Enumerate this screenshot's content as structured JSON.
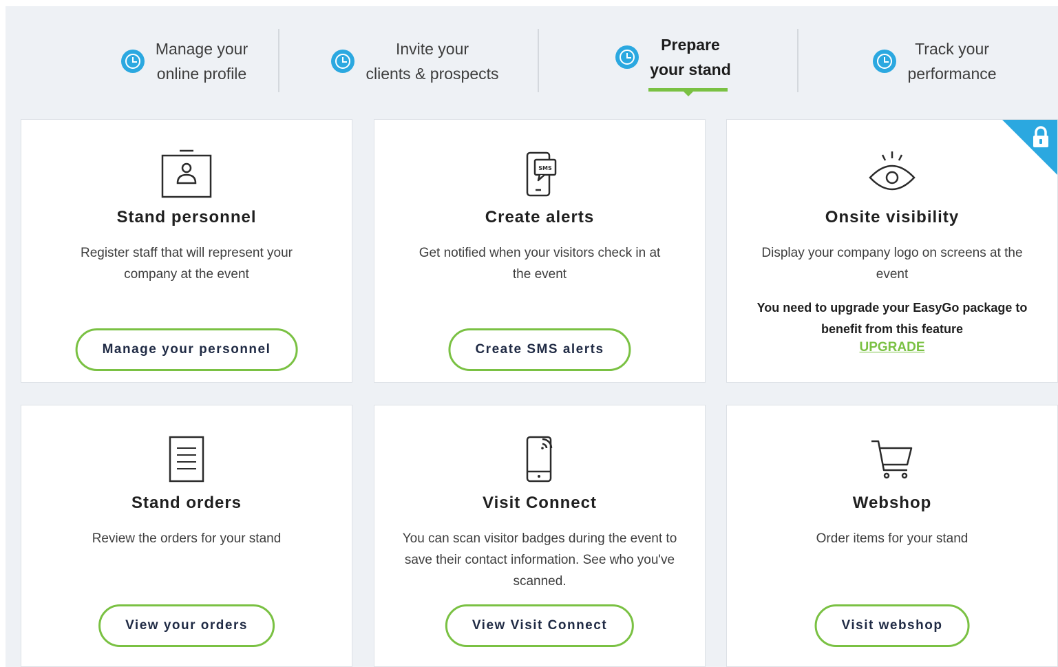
{
  "steps": [
    {
      "label": "Manage your\nonline profile",
      "active": false
    },
    {
      "label": "Invite your\nclients & prospects",
      "active": false
    },
    {
      "label": "Prepare\nyour stand",
      "active": true
    },
    {
      "label": "Track your\nperformance",
      "active": false
    }
  ],
  "cards": [
    {
      "icon": "badge-icon",
      "title": "Stand personnel",
      "description": "Register staff that will represent your company at the event",
      "button": "Manage your personnel"
    },
    {
      "icon": "sms-phone-icon",
      "title": "Create alerts",
      "description": "Get notified when your visitors check in at the event",
      "button": "Create SMS alerts",
      "icon_text": "SMS"
    },
    {
      "icon": "eye-icon",
      "title": "Onsite visibility",
      "description": "Display your company logo on screens at the event",
      "locked": true,
      "lock_icon": "lock-icon",
      "note": "You need to upgrade your EasyGo package to benefit from this feature",
      "upgrade_link": "UPGRADE"
    },
    {
      "icon": "document-icon",
      "title": "Stand orders",
      "description": "Review the orders for your stand",
      "button": "View your orders"
    },
    {
      "icon": "phone-wireless-icon",
      "title": "Visit Connect",
      "description": "You can scan visitor badges during the event to save their contact information. See who you've scanned.",
      "button": "View Visit Connect"
    },
    {
      "icon": "cart-icon",
      "title": "Webshop",
      "description": "Order items for your stand",
      "button": "Visit webshop"
    }
  ],
  "colors": {
    "accent_green": "#7ac143",
    "accent_blue": "#2ba8e0",
    "background": "#eef1f5"
  }
}
